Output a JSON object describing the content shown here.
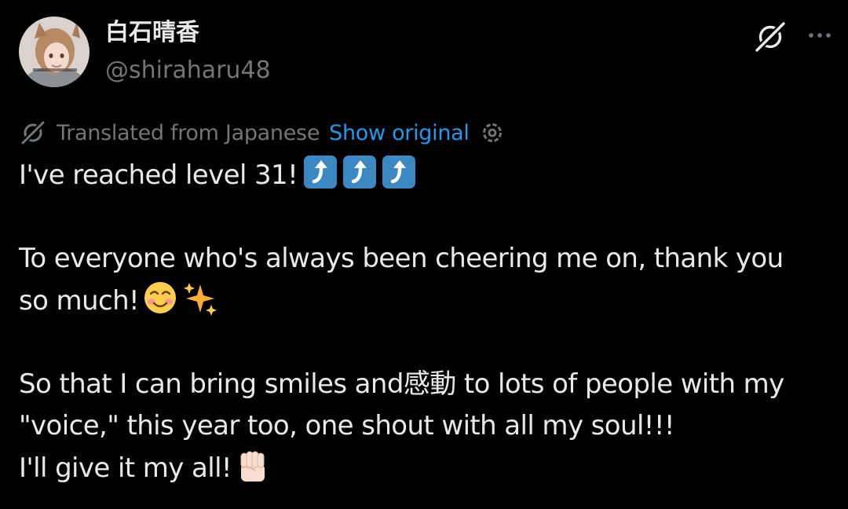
{
  "author": {
    "display_name": "白石晴香",
    "handle": "@shiraharu48"
  },
  "icons": {
    "grok": "grok-icon",
    "more": "more-horizontal-icon",
    "translate": "grok-translate-icon",
    "settings": "gear-icon"
  },
  "translation": {
    "label": "Translated from Japanese",
    "show_original": "Show original"
  },
  "tweet": {
    "line1": "I've reached level 31!",
    "line2": "To everyone who's always been cheering me on, thank you",
    "line3": "so much!",
    "line4": "So that I can bring smiles and感動 to lots of people with my",
    "line5": "\"voice,\" this year too, one shout with all my soul!!!",
    "line6": "I'll give it my all!",
    "emojis": {
      "line1": [
        "up-arrow-emoji",
        "up-arrow-emoji",
        "up-arrow-emoji"
      ],
      "line3": [
        "smiling-face-emoji",
        "sparkles-emoji"
      ],
      "line6": [
        "raised-fist-emoji"
      ]
    }
  },
  "colors": {
    "background": "#000000",
    "text_primary": "#e7e9ea",
    "text_secondary": "#71767b",
    "link": "#1d9bf0",
    "arrow_emoji_bg": "#3b88c3"
  }
}
